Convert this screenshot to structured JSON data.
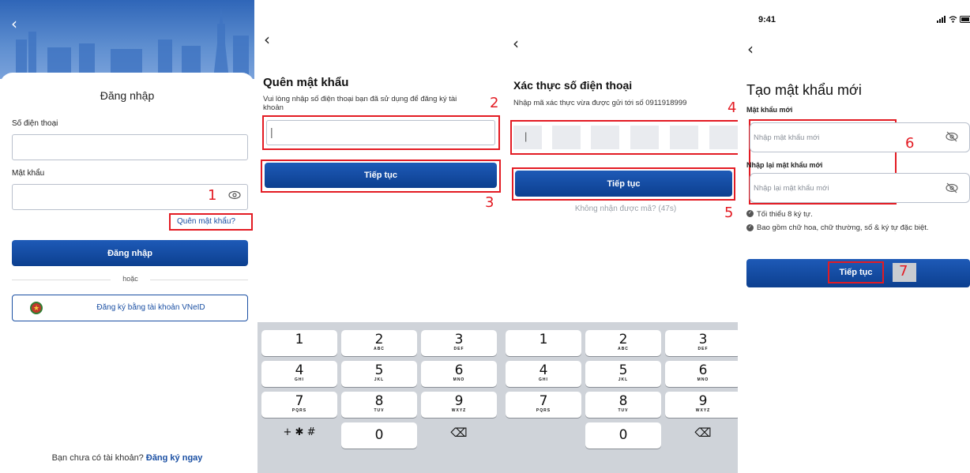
{
  "panel1": {
    "title": "Đăng nhập",
    "phone_label": "Số điện thoại",
    "password_label": "Mật khẩu",
    "forgot_link": "Quên mật khẩu?",
    "login_button": "Đăng nhập",
    "or_text": "hoặc",
    "vneid_button": "Đăng ký bằng tài khoản VNeID",
    "footer_question": "Bạn chưa có tài khoản?",
    "footer_link": "Đăng ký ngay",
    "step": "1"
  },
  "panel2": {
    "title": "Quên mật khẩu",
    "description": "Vui lòng nhập số điện thoại bạn đã sử dụng để đăng ký tài khoản",
    "phone_value": "|",
    "continue_button": "Tiếp tục",
    "step_input": "2",
    "step_button": "3"
  },
  "panel3": {
    "title": "Xác thực số điện thoại",
    "description": "Nhập mã xác thực vừa được gửi tới số 0911918999",
    "cursor": "|",
    "continue_button": "Tiếp tục",
    "resend_text": "Không nhận được mã? (47s)",
    "step_input": "4",
    "step_button": "5"
  },
  "panel4": {
    "status_time": "9:41",
    "status_icons": "signal-wifi-battery",
    "title": "Tạo mật khẩu mới",
    "new_label": "Mật khẩu mới",
    "new_placeholder": "Nhập mật khẩu mới",
    "confirm_label": "Nhập lại mật khẩu mới",
    "confirm_placeholder": "Nhập lại mật khẩu mới",
    "rule1": "Tối thiểu 8 ký tự.",
    "rule2": "Bao gồm chữ hoa, chữ thường, số & ký tự đặc biệt.",
    "continue_button": "Tiếp tục",
    "step_fields": "6",
    "step_button": "7"
  },
  "keypad": {
    "keys": [
      {
        "num": "1",
        "letters": ""
      },
      {
        "num": "2",
        "letters": "ABC"
      },
      {
        "num": "3",
        "letters": "DEF"
      },
      {
        "num": "4",
        "letters": "GHI"
      },
      {
        "num": "5",
        "letters": "JKL"
      },
      {
        "num": "6",
        "letters": "MNO"
      },
      {
        "num": "7",
        "letters": "PQRS"
      },
      {
        "num": "8",
        "letters": "TUV"
      },
      {
        "num": "9",
        "letters": "WXYZ"
      }
    ],
    "zero": "0",
    "symbols": "+ ✱ #",
    "delete": "⌫"
  },
  "colors": {
    "primary": "#0c3f8f",
    "link": "#1a4fa3",
    "annotation": "#e31b23"
  }
}
